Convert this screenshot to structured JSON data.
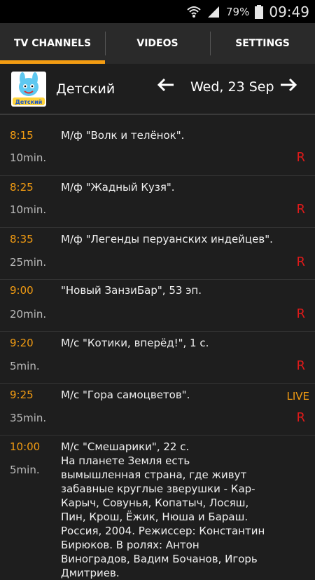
{
  "statusbar": {
    "battery": "79%",
    "time": "09:49"
  },
  "tabs": [
    {
      "label": "TV CHANNELS",
      "active": true
    },
    {
      "label": "VIDEOS",
      "active": false
    },
    {
      "label": "SETTINGS",
      "active": false
    }
  ],
  "channel": {
    "name": "Детский",
    "logo_text": "Детский",
    "date": "Wed, 23 Sep"
  },
  "programs": [
    {
      "time": "8:15",
      "duration": "10min.",
      "title": "М/ф \"Волк и телёнок\".",
      "rec": "R"
    },
    {
      "time": "8:25",
      "duration": "10min.",
      "title": "М/ф \"Жадный Кузя\".",
      "rec": "R"
    },
    {
      "time": "8:35",
      "duration": "25min.",
      "title": "М/ф \"Легенды перуанских индейцев\".",
      "rec": "R"
    },
    {
      "time": "9:00",
      "duration": "20min.",
      "title": "\"Новый ЗанзиБар\", 53 эп.",
      "rec": "R"
    },
    {
      "time": "9:20",
      "duration": "5min.",
      "title": "М/с \"Котики, вперёд!\", 1 с.",
      "rec": "R"
    },
    {
      "time": "9:25",
      "duration": "35min.",
      "title": "М/с \"Гора самоцветов\".",
      "rec": "R",
      "live": "LIVE"
    },
    {
      "time": "10:00",
      "duration": "5min.",
      "title": "М/с \"Смешарики\", 22 с.",
      "description": "На планете Земля есть вымышленная страна, где живут забавные круглые зверушки - Кар-Карыч, Совунья, Копатыч, Лосяш, Пин, Крош, Ёжик, Нюша и Бараш. Россия, 2004. Режиссер: Константин Бирюков. В ролях: Антон Виноградов, Вадим Бочанов, Игорь Дмитриев."
    }
  ],
  "colors": {
    "accent": "#f39c12",
    "record": "#e01a1a",
    "background": "#1e1e1e"
  },
  "icons": [
    "wifi-icon",
    "signal-icon",
    "battery-icon",
    "arrow-left-icon",
    "arrow-right-icon",
    "channel-logo"
  ]
}
